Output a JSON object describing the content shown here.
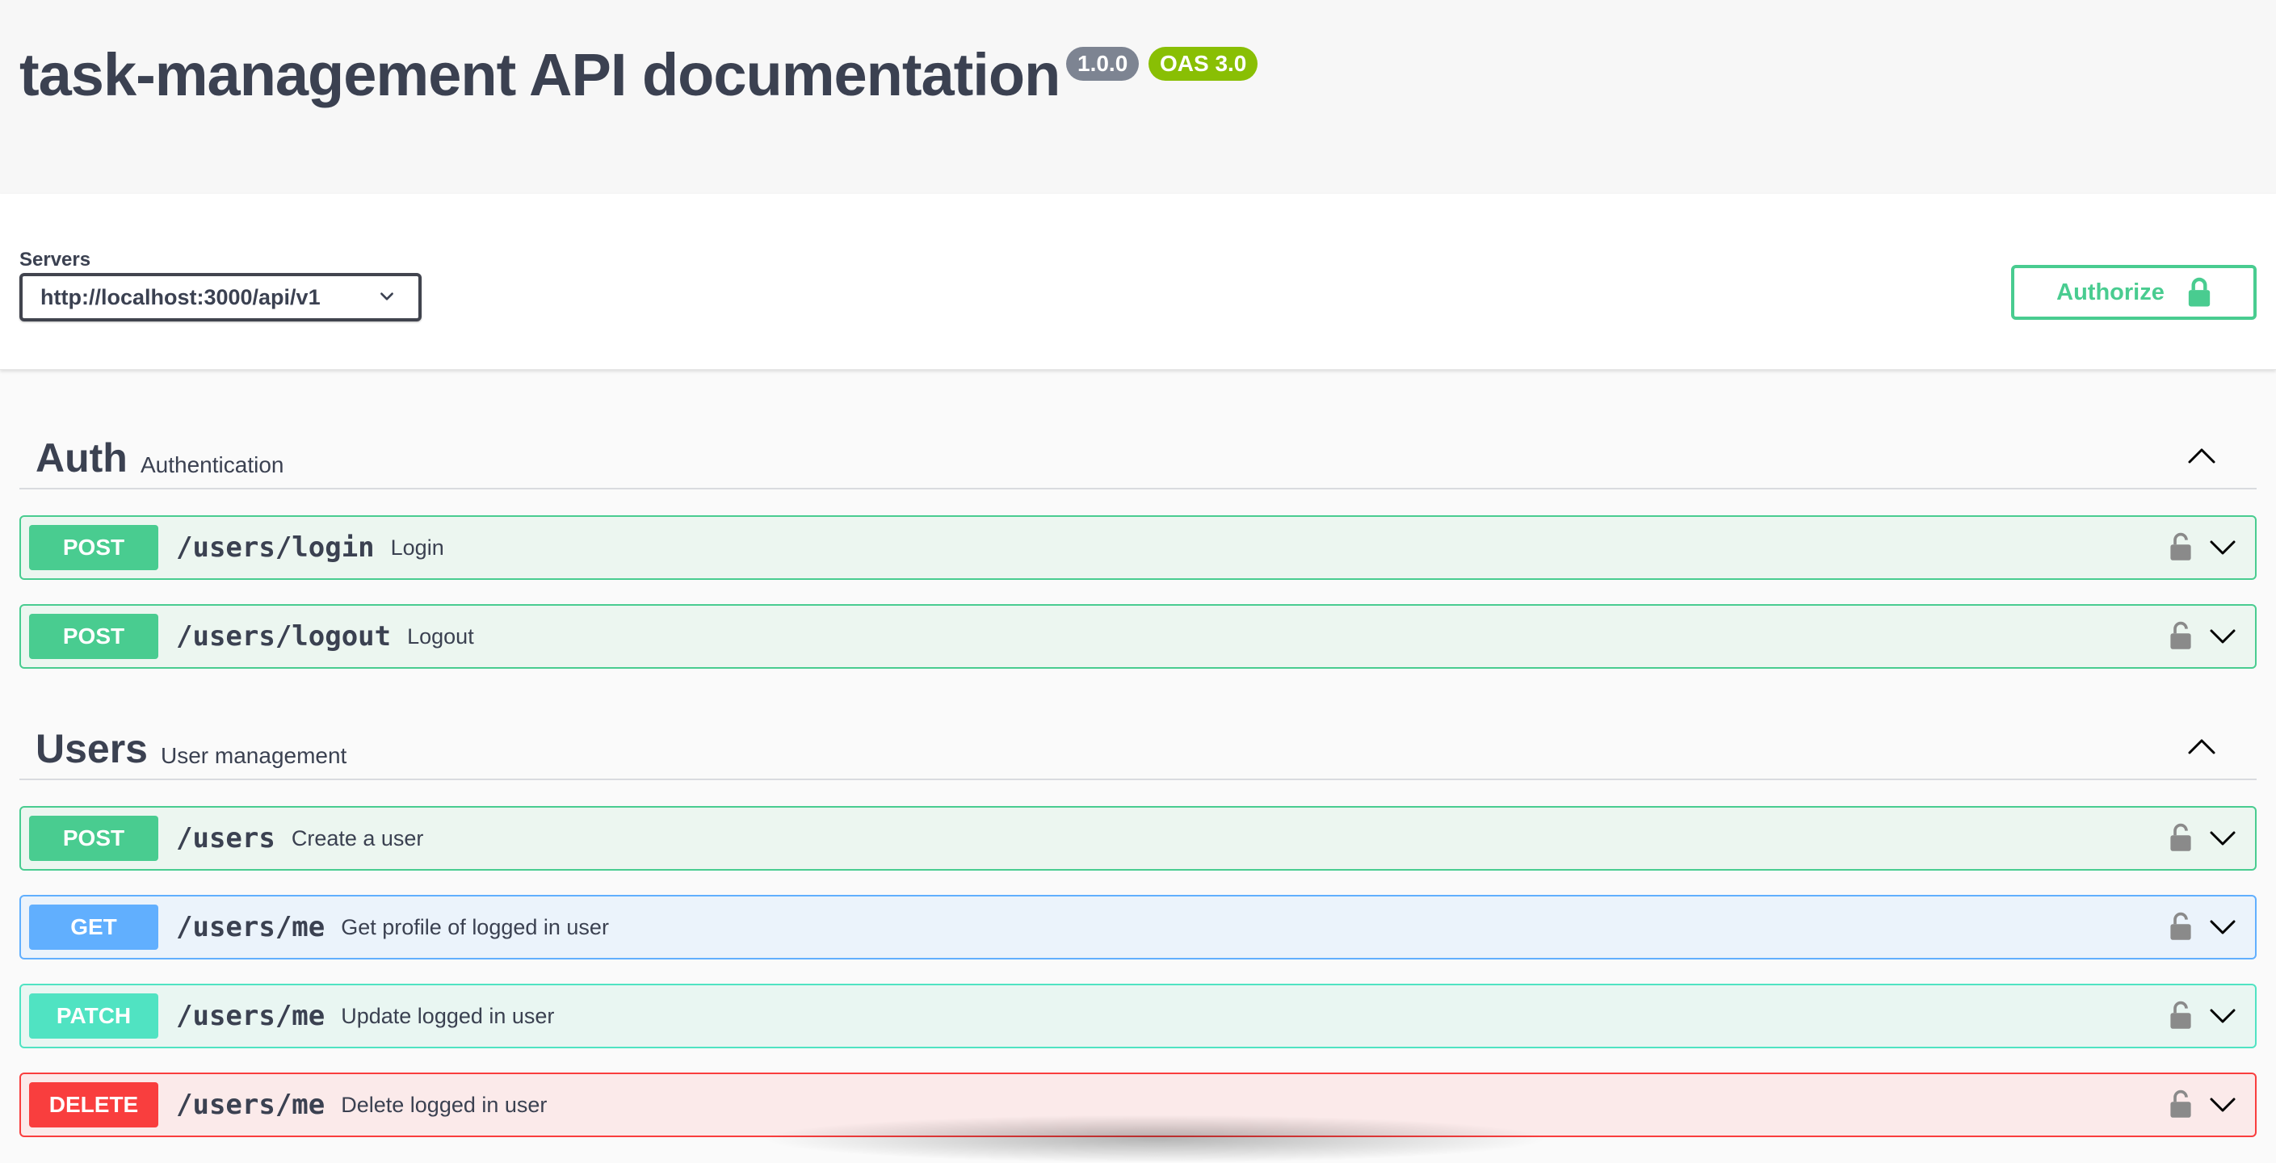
{
  "header": {
    "title": "task-management API documentation",
    "version_badge": "1.0.0",
    "oas_badge": "OAS 3.0"
  },
  "servers": {
    "label": "Servers",
    "selected": "http://localhost:3000/api/v1"
  },
  "authorize": {
    "label": "Authorize"
  },
  "tags": [
    {
      "name": "Auth",
      "description": "Authentication",
      "operations": [
        {
          "method": "POST",
          "path": "/users/login",
          "summary": "Login"
        },
        {
          "method": "POST",
          "path": "/users/logout",
          "summary": "Logout"
        }
      ]
    },
    {
      "name": "Users",
      "description": "User management",
      "operations": [
        {
          "method": "POST",
          "path": "/users",
          "summary": "Create a user"
        },
        {
          "method": "GET",
          "path": "/users/me",
          "summary": "Get profile of logged in user"
        },
        {
          "method": "PATCH",
          "path": "/users/me",
          "summary": "Update logged in user"
        },
        {
          "method": "DELETE",
          "path": "/users/me",
          "summary": "Delete logged in user"
        }
      ]
    }
  ],
  "icons": {
    "collapse": "chevron-up-icon",
    "expand": "chevron-down-icon",
    "lock": "lock-icon"
  },
  "colors": {
    "post": "#49cc90",
    "get": "#61affe",
    "patch": "#50e3c2",
    "delete": "#f93e3e",
    "version_badge": "#7d8492",
    "oas_badge": "#89bf04"
  }
}
